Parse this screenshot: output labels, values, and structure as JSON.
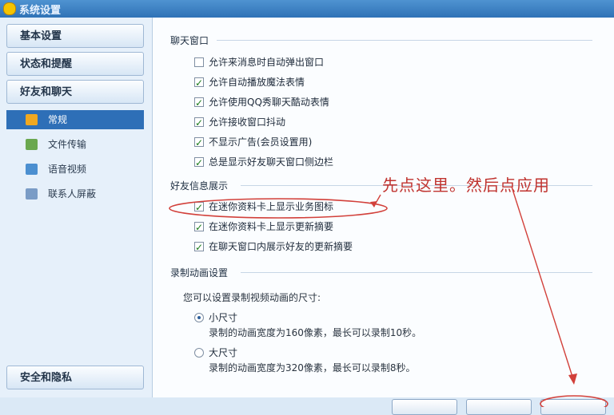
{
  "window": {
    "title": "系统设置"
  },
  "sidebar": {
    "categories": [
      "基本设置",
      "状态和提醒",
      "好友和聊天",
      "安全和隐私"
    ],
    "items": [
      {
        "label": "常规",
        "icon": "general-icon"
      },
      {
        "label": "文件传输",
        "icon": "file-transfer-icon"
      },
      {
        "label": "语音视频",
        "icon": "voice-video-icon"
      },
      {
        "label": "联系人屏蔽",
        "icon": "contact-block-icon"
      }
    ]
  },
  "chat_window": {
    "title": "聊天窗口",
    "options": [
      {
        "label": "允许来消息时自动弹出窗口",
        "checked": false
      },
      {
        "label": "允许自动播放魔法表情",
        "checked": true
      },
      {
        "label": "允许使用QQ秀聊天酷动表情",
        "checked": true
      },
      {
        "label": "允许接收窗口抖动",
        "checked": true
      },
      {
        "label": "不显示广告(会员设置用)",
        "checked": true
      },
      {
        "label": "总是显示好友聊天窗口侧边栏",
        "checked": true
      }
    ]
  },
  "friend_info": {
    "title": "好友信息展示",
    "options": [
      {
        "label": "在迷你资料卡上显示业务图标",
        "checked": true
      },
      {
        "label": "在迷你资料卡上显示更新摘要",
        "checked": true
      },
      {
        "label": "在聊天窗口内展示好友的更新摘要",
        "checked": true
      }
    ]
  },
  "recording": {
    "title": "录制动画设置",
    "prompt": "您可以设置录制视频动画的尺寸:",
    "sizes": [
      {
        "label": "小尺寸",
        "desc": "录制的动画宽度为160像素，最长可以录制10秒。",
        "selected": true
      },
      {
        "label": "大尺寸",
        "desc": "录制的动画宽度为320像素，最长可以录制8秒。",
        "selected": false
      }
    ]
  },
  "annotation": {
    "text": "先点这里。然后点应用",
    "color": "#c0332f"
  },
  "colors": {
    "accent": "#2e6fb7",
    "panel": "#fbfdff"
  }
}
